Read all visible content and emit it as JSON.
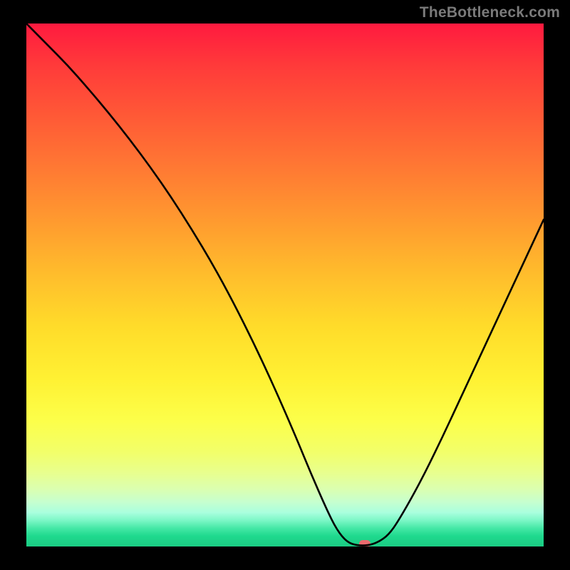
{
  "watermark": "TheBottleneck.com",
  "colors": {
    "frame": "#000000",
    "marker": "#ec6a6e",
    "curve": "#000000",
    "gradient_top": "#ff1a3f",
    "gradient_bottom": "#1bcc83"
  },
  "chart_data": {
    "type": "line",
    "title": "",
    "xlabel": "",
    "ylabel": "",
    "xlim": [
      0,
      100
    ],
    "ylim": [
      0,
      100
    ],
    "grid": false,
    "legend": false,
    "curve_xy": [
      [
        0,
        100
      ],
      [
        4,
        96
      ],
      [
        8,
        92
      ],
      [
        12,
        87.5
      ],
      [
        16,
        82.8
      ],
      [
        20,
        77.8
      ],
      [
        24,
        72.5
      ],
      [
        28,
        66.8
      ],
      [
        32,
        60.6
      ],
      [
        36,
        54.0
      ],
      [
        40,
        46.7
      ],
      [
        44,
        38.8
      ],
      [
        48,
        30.3
      ],
      [
        52,
        21.2
      ],
      [
        55,
        14.0
      ],
      [
        58,
        7.2
      ],
      [
        60,
        3.2
      ],
      [
        62,
        0.8
      ],
      [
        64,
        0.2
      ],
      [
        66,
        0.2
      ],
      [
        68,
        0.8
      ],
      [
        70,
        2.2
      ],
      [
        72,
        5.0
      ],
      [
        76,
        12.0
      ],
      [
        80,
        20.0
      ],
      [
        84,
        28.5
      ],
      [
        88,
        37.0
      ],
      [
        92,
        45.5
      ],
      [
        96,
        54.0
      ],
      [
        100,
        62.5
      ]
    ],
    "marker": {
      "x": 65.4,
      "y": 0.6
    }
  }
}
